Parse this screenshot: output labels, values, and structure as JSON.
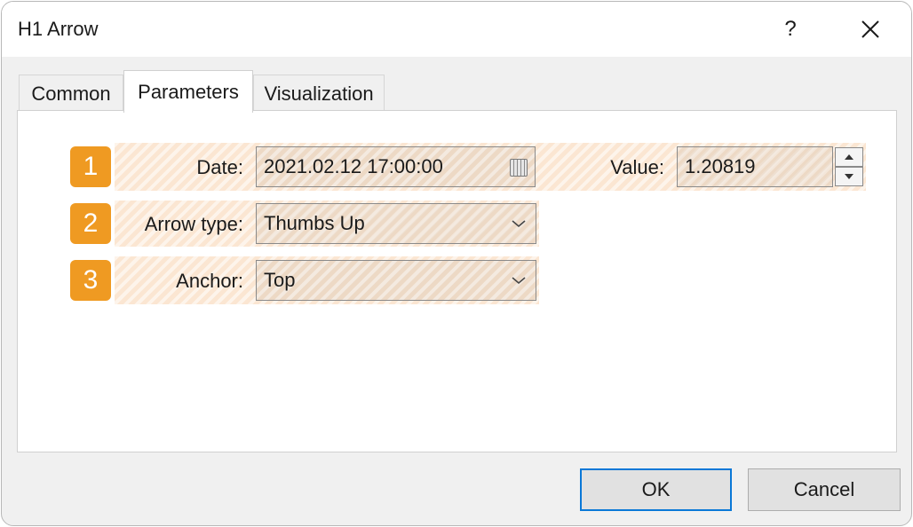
{
  "window": {
    "title": "H1 Arrow",
    "help_glyph": "?",
    "close_glyph": "✕"
  },
  "tabs": [
    {
      "label": "Common",
      "selected": false
    },
    {
      "label": "Parameters",
      "selected": true
    },
    {
      "label": "Visualization",
      "selected": false
    }
  ],
  "parameters": {
    "date": {
      "badge": "1",
      "label": "Date:",
      "value": "2021.02.12 17:00:00"
    },
    "value": {
      "label": "Value:",
      "value": "1.20819"
    },
    "arrow_type": {
      "badge": "2",
      "label": "Arrow type:",
      "value": "Thumbs Up"
    },
    "anchor": {
      "badge": "3",
      "label": "Anchor:",
      "value": "Top"
    }
  },
  "buttons": {
    "ok": "OK",
    "cancel": "Cancel"
  },
  "colors": {
    "badge": "#ef9a22",
    "highlight": "#fbe6d2",
    "focus_border": "#0a78d7"
  },
  "icons": {
    "date": "calendar-icon",
    "dropdown": "chevron-down-icon",
    "spin_up": "triangle-up-icon",
    "spin_down": "triangle-down-icon",
    "close": "close-icon"
  }
}
